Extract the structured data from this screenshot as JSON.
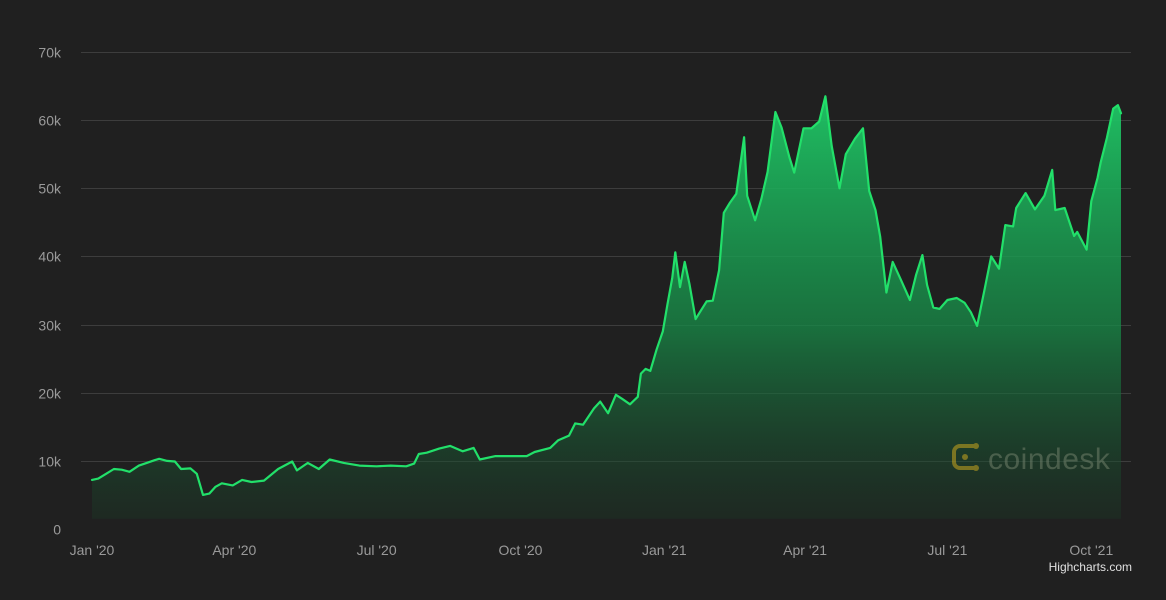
{
  "chart_data": {
    "type": "area",
    "title": "",
    "xlabel": "",
    "ylabel": "",
    "x_axis": {
      "type": "datetime",
      "range": [
        "2020-01-01",
        "2021-10-20"
      ],
      "ticks": [
        {
          "date": "2020-01-01",
          "label": "Jan '20"
        },
        {
          "date": "2020-04-01",
          "label": "Apr '20"
        },
        {
          "date": "2020-07-01",
          "label": "Jul '20"
        },
        {
          "date": "2020-10-01",
          "label": "Oct '20"
        },
        {
          "date": "2021-01-01",
          "label": "Jan '21"
        },
        {
          "date": "2021-04-01",
          "label": "Apr '21"
        },
        {
          "date": "2021-07-01",
          "label": "Jul '21"
        },
        {
          "date": "2021-10-01",
          "label": "Oct '21"
        }
      ]
    },
    "y_axis": {
      "ylim": [
        0,
        70000
      ],
      "ticks": [
        {
          "value": 0,
          "label": "0"
        },
        {
          "value": 10000,
          "label": "10k"
        },
        {
          "value": 20000,
          "label": "20k"
        },
        {
          "value": 30000,
          "label": "30k"
        },
        {
          "value": 40000,
          "label": "40k"
        },
        {
          "value": 50000,
          "label": "50k"
        },
        {
          "value": 60000,
          "label": "60k"
        },
        {
          "value": 70000,
          "label": "70k"
        }
      ]
    },
    "grid": true,
    "legend": "none",
    "colors": {
      "background": "#202020",
      "line": "#22e06a",
      "fill_top": "#1fc766",
      "fill_bottom": "#1a3a26",
      "grid": "#3d3d3d"
    },
    "series": [
      {
        "points": [
          [
            "2020-01-01",
            7200
          ],
          [
            "2020-01-05",
            7400
          ],
          [
            "2020-01-10",
            8100
          ],
          [
            "2020-01-15",
            8800
          ],
          [
            "2020-01-20",
            8700
          ],
          [
            "2020-01-25",
            8400
          ],
          [
            "2020-01-31",
            9300
          ],
          [
            "2020-02-05",
            9700
          ],
          [
            "2020-02-10",
            10100
          ],
          [
            "2020-02-13",
            10300
          ],
          [
            "2020-02-18",
            10000
          ],
          [
            "2020-02-23",
            9900
          ],
          [
            "2020-02-27",
            8800
          ],
          [
            "2020-03-04",
            8900
          ],
          [
            "2020-03-08",
            8100
          ],
          [
            "2020-03-12",
            5000
          ],
          [
            "2020-03-16",
            5200
          ],
          [
            "2020-03-20",
            6200
          ],
          [
            "2020-03-24",
            6700
          ],
          [
            "2020-03-31",
            6400
          ],
          [
            "2020-04-06",
            7200
          ],
          [
            "2020-04-12",
            6900
          ],
          [
            "2020-04-20",
            7100
          ],
          [
            "2020-04-29",
            8800
          ],
          [
            "2020-05-08",
            9900
          ],
          [
            "2020-05-11",
            8600
          ],
          [
            "2020-05-18",
            9700
          ],
          [
            "2020-05-25",
            8800
          ],
          [
            "2020-06-01",
            10200
          ],
          [
            "2020-06-10",
            9700
          ],
          [
            "2020-06-20",
            9300
          ],
          [
            "2020-07-01",
            9200
          ],
          [
            "2020-07-10",
            9300
          ],
          [
            "2020-07-20",
            9200
          ],
          [
            "2020-07-25",
            9600
          ],
          [
            "2020-07-28",
            11000
          ],
          [
            "2020-08-02",
            11200
          ],
          [
            "2020-08-10",
            11800
          ],
          [
            "2020-08-17",
            12200
          ],
          [
            "2020-08-25",
            11400
          ],
          [
            "2020-09-01",
            11900
          ],
          [
            "2020-09-05",
            10200
          ],
          [
            "2020-09-15",
            10700
          ],
          [
            "2020-09-25",
            10700
          ],
          [
            "2020-10-05",
            10700
          ],
          [
            "2020-10-10",
            11300
          ],
          [
            "2020-10-20",
            11900
          ],
          [
            "2020-10-25",
            13000
          ],
          [
            "2020-11-01",
            13700
          ],
          [
            "2020-11-05",
            15500
          ],
          [
            "2020-11-10",
            15300
          ],
          [
            "2020-11-17",
            17700
          ],
          [
            "2020-11-21",
            18700
          ],
          [
            "2020-11-26",
            17000
          ],
          [
            "2020-12-01",
            19700
          ],
          [
            "2020-12-05",
            19100
          ],
          [
            "2020-12-10",
            18300
          ],
          [
            "2020-12-15",
            19400
          ],
          [
            "2020-12-17",
            22800
          ],
          [
            "2020-12-20",
            23500
          ],
          [
            "2020-12-23",
            23200
          ],
          [
            "2020-12-27",
            26300
          ],
          [
            "2020-12-31",
            29000
          ],
          [
            "2021-01-03",
            33000
          ],
          [
            "2021-01-06",
            36800
          ],
          [
            "2021-01-08",
            40600
          ],
          [
            "2021-01-11",
            35500
          ],
          [
            "2021-01-14",
            39200
          ],
          [
            "2021-01-17",
            36000
          ],
          [
            "2021-01-21",
            30800
          ],
          [
            "2021-01-25",
            32300
          ],
          [
            "2021-01-28",
            33400
          ],
          [
            "2021-02-01",
            33500
          ],
          [
            "2021-02-05",
            38000
          ],
          [
            "2021-02-08",
            46400
          ],
          [
            "2021-02-12",
            47900
          ],
          [
            "2021-02-16",
            49200
          ],
          [
            "2021-02-21",
            57500
          ],
          [
            "2021-02-23",
            48900
          ],
          [
            "2021-02-28",
            45300
          ],
          [
            "2021-03-04",
            48400
          ],
          [
            "2021-03-08",
            52400
          ],
          [
            "2021-03-13",
            61200
          ],
          [
            "2021-03-17",
            58900
          ],
          [
            "2021-03-22",
            54500
          ],
          [
            "2021-03-25",
            52300
          ],
          [
            "2021-03-31",
            58800
          ],
          [
            "2021-04-05",
            58800
          ],
          [
            "2021-04-10",
            59800
          ],
          [
            "2021-04-14",
            63500
          ],
          [
            "2021-04-18",
            56200
          ],
          [
            "2021-04-23",
            50000
          ],
          [
            "2021-04-27",
            55000
          ],
          [
            "2021-05-03",
            57300
          ],
          [
            "2021-05-08",
            58800
          ],
          [
            "2021-05-12",
            49600
          ],
          [
            "2021-05-16",
            46800
          ],
          [
            "2021-05-19",
            42900
          ],
          [
            "2021-05-23",
            34700
          ],
          [
            "2021-05-27",
            39200
          ],
          [
            "2021-06-01",
            36700
          ],
          [
            "2021-06-07",
            33600
          ],
          [
            "2021-06-11",
            37300
          ],
          [
            "2021-06-15",
            40200
          ],
          [
            "2021-06-18",
            35800
          ],
          [
            "2021-06-22",
            32500
          ],
          [
            "2021-06-26",
            32300
          ],
          [
            "2021-07-01",
            33600
          ],
          [
            "2021-07-07",
            33900
          ],
          [
            "2021-07-12",
            33200
          ],
          [
            "2021-07-16",
            31800
          ],
          [
            "2021-07-20",
            29800
          ],
          [
            "2021-07-25",
            35400
          ],
          [
            "2021-07-29",
            40000
          ],
          [
            "2021-08-03",
            38200
          ],
          [
            "2021-08-07",
            44600
          ],
          [
            "2021-08-12",
            44400
          ],
          [
            "2021-08-14",
            47100
          ],
          [
            "2021-08-20",
            49300
          ],
          [
            "2021-08-26",
            46900
          ],
          [
            "2021-09-01",
            48900
          ],
          [
            "2021-09-06",
            52700
          ],
          [
            "2021-09-08",
            46800
          ],
          [
            "2021-09-14",
            47100
          ],
          [
            "2021-09-20",
            43000
          ],
          [
            "2021-09-22",
            43600
          ],
          [
            "2021-09-28",
            41000
          ],
          [
            "2021-10-01",
            48100
          ],
          [
            "2021-10-05",
            51500
          ],
          [
            "2021-10-07",
            53800
          ],
          [
            "2021-10-11",
            57400
          ],
          [
            "2021-10-15",
            61700
          ],
          [
            "2021-10-18",
            62200
          ],
          [
            "2021-10-20",
            61000
          ]
        ]
      }
    ]
  },
  "watermark": {
    "text": "coindesk",
    "icon": "coindesk-logo-icon"
  },
  "credits": {
    "text": "Highcharts.com"
  }
}
